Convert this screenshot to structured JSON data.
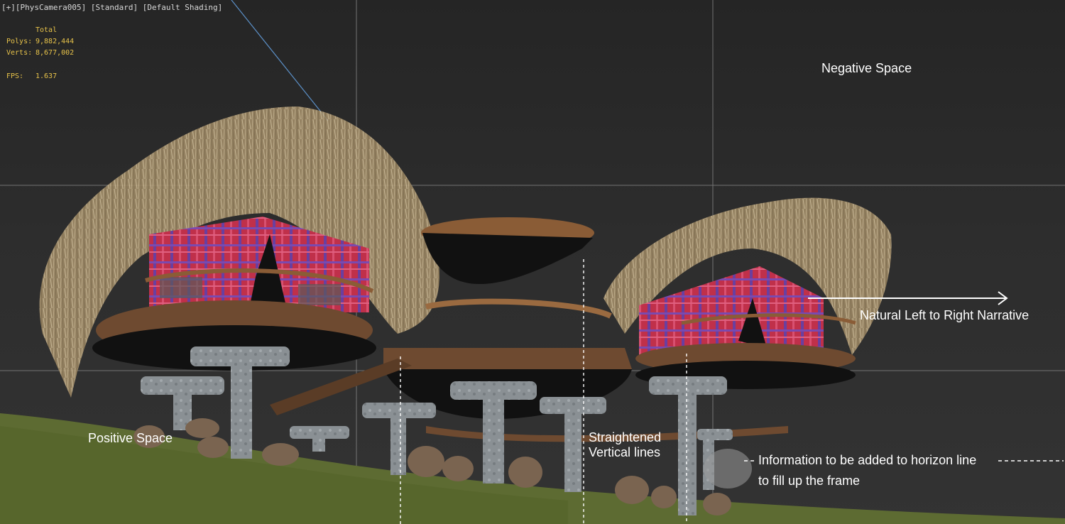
{
  "viewport": {
    "label_plus": "[+]",
    "label_camera": "[PhysCamera005]",
    "label_mode": "[Standard]",
    "label_shading": "[Default Shading]"
  },
  "stats": {
    "header": "Total",
    "polys_label": "Polys:",
    "polys_value": "9,882,444",
    "verts_label": "Verts:",
    "verts_value": "8,677,002",
    "fps_label": "FPS:",
    "fps_value": "1.637"
  },
  "annotations": {
    "negative_space": "Negative Space",
    "narrative": "Natural Left to Right Narrative",
    "positive_space": "Positive Space",
    "straightened_1": "Straightened",
    "straightened_2": "Vertical lines",
    "info_1": "Information to be added to horizon line",
    "info_2": "to fill up the frame"
  },
  "colors": {
    "stats_text": "#e8c34a",
    "grid_line": "#8c8c8c",
    "annotation_text": "#ffffff",
    "roof_thatch": "#c9b48e",
    "wall_fabric": "#c0304a",
    "deck_wood": "#7a5034",
    "pillar_stone": "#8e9498",
    "ground": "#5d6b32"
  }
}
